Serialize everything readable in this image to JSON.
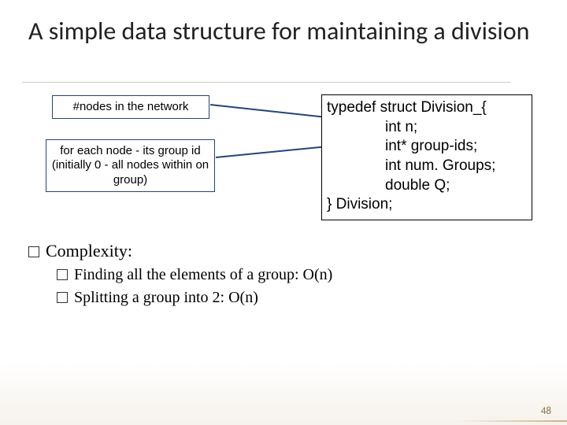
{
  "title": "A simple data structure for maintaining a division",
  "annot1": "#nodes in the network",
  "annot2": "for each node - its group id (initially 0 - all nodes within on group)",
  "code": {
    "l1": "typedef struct Division_{",
    "l2": "int n;",
    "l3": "int* group-ids;",
    "l4": "int num. Groups;",
    "l5": "double Q;",
    "l6": "} Division;"
  },
  "bullets": {
    "complexity": "Complexity:",
    "finding": "Finding all the elements of a group: O(n)",
    "splitting": "Splitting a group into 2: O(n)"
  },
  "pagenum": "48"
}
